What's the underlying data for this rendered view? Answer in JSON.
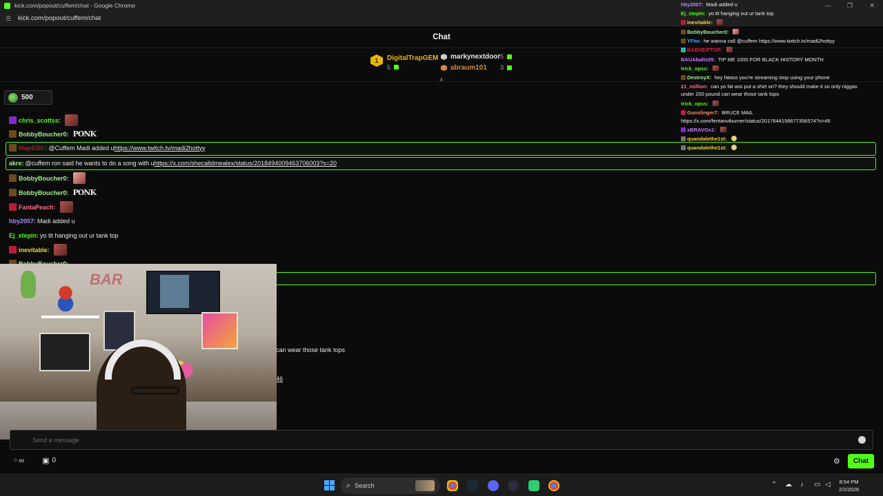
{
  "window": {
    "title": "kick.com/popout/cuffem/chat - Google Chrome",
    "url": "kick.com/popout/cuffem/chat"
  },
  "header": {
    "title": "Chat"
  },
  "leaderboard": [
    {
      "rank": "1",
      "name": "DigitalTrapGEM",
      "value": "5",
      "color": "#e9b30b"
    },
    {
      "name": "markynextdoor",
      "value": "5",
      "color": "#e8e8e8"
    },
    {
      "name": "abraum101",
      "value": "3",
      "color": "#d38a3e"
    }
  ],
  "kicks": {
    "value": "500"
  },
  "messages": [
    {
      "user": "chris_scottss:",
      "color": "#53fc18",
      "text": ""
    },
    {
      "user": "BobbyBoucher0:",
      "color": "#9ff28d",
      "text": ""
    },
    {
      "user": "MajoEBII",
      "color": "#e11d3a",
      "text": ": @Cuffem Madi added u ",
      "link": "https://www.twitch.tv/madi2hottyy"
    },
    {
      "user": "akre:",
      "color": "#9ff28d",
      "text": " @cuffem ron said he wants to do a song with u ",
      "link": "https://x.com/shecalldmealex/status/2018494009463706003?s=20"
    },
    {
      "user": "BobbyBoucher0:",
      "color": "#9ff28d",
      "text": ""
    },
    {
      "user": "BobbyBoucher0:",
      "color": "#9ff28d",
      "text": ""
    },
    {
      "user": "FantaPeach:",
      "color": "#ff6b8b",
      "text": ""
    },
    {
      "user": "hby2007:",
      "color": "#b18cff",
      "text": " Madi added u"
    },
    {
      "user": "Ej_stepin:",
      "color": "#53fc18",
      "text": " yo tit hanging out ur tank top"
    },
    {
      "user": "inevitable:",
      "color": "#f2d13a",
      "text": ""
    },
    {
      "user": "BobbyBoucher0:",
      "color": "#9ff28d",
      "text": ""
    }
  ],
  "partial": {
    "tank_text": "can wear those tank tops",
    "link_tail": "46"
  },
  "input": {
    "placeholder": "Send a message"
  },
  "footer": {
    "count": "0",
    "chat_button": "Chat"
  },
  "overlay": [
    {
      "user": "hby2007:",
      "color": "#b18cff",
      "text": "Madi added u"
    },
    {
      "user": "Ej_stepin:",
      "color": "#53fc18",
      "text": "yo tit hanging out ur tank top"
    },
    {
      "user": "Inevitable:",
      "color": "#f2d13a",
      "text": ""
    },
    {
      "user": "BobbyBoucher0:",
      "color": "#9ff28d",
      "text": ""
    },
    {
      "user": "YFiw:",
      "color": "#4aa8ff",
      "text": "he wanna call @cuffem https://www.twitch.tv/madi2hottyy"
    },
    {
      "user": "BAEHEIPTOP:",
      "color": "#e11d3a",
      "text": ""
    },
    {
      "user": "BAUAbalts05:",
      "color": "#c77dff",
      "text": "TIP ME 1000 FOR BLACK HISTORY MONTH"
    },
    {
      "user": "trick_opss:",
      "color": "#53fc18",
      "text": ""
    },
    {
      "user": "DestroyX:",
      "color": "#9ff28d",
      "text": "hey fatass you're streaming stop using your phone"
    },
    {
      "user": "21_million:",
      "color": "#ff6b8b",
      "text": "can yo fat ass put a shirt on? they should make it so only niggas"
    },
    {
      "user": "",
      "color": "#f0f0f0",
      "text": "under 200 pound can wear those tank tops"
    },
    {
      "user": "trick_opss:",
      "color": "#53fc18",
      "text": ""
    },
    {
      "user": "Gunslinger7:",
      "color": "#ff8a65",
      "text": "BRUCE MAIL"
    },
    {
      "user": "",
      "color": "#f0f0f0",
      "text": "https://x.com/fentanviburner/status/2017644158677356574?s=46"
    },
    {
      "user": "xBRAVOx1:",
      "color": "#c77dff",
      "text": ""
    },
    {
      "user": "quandalethe1st:",
      "color": "#f2d13a",
      "text": ""
    },
    {
      "user": "quandalethe1st:",
      "color": "#f2d13a",
      "text": ""
    }
  ],
  "taskbar": {
    "search": "Search",
    "time": "8:54 PM",
    "date": "2/2/2026"
  }
}
